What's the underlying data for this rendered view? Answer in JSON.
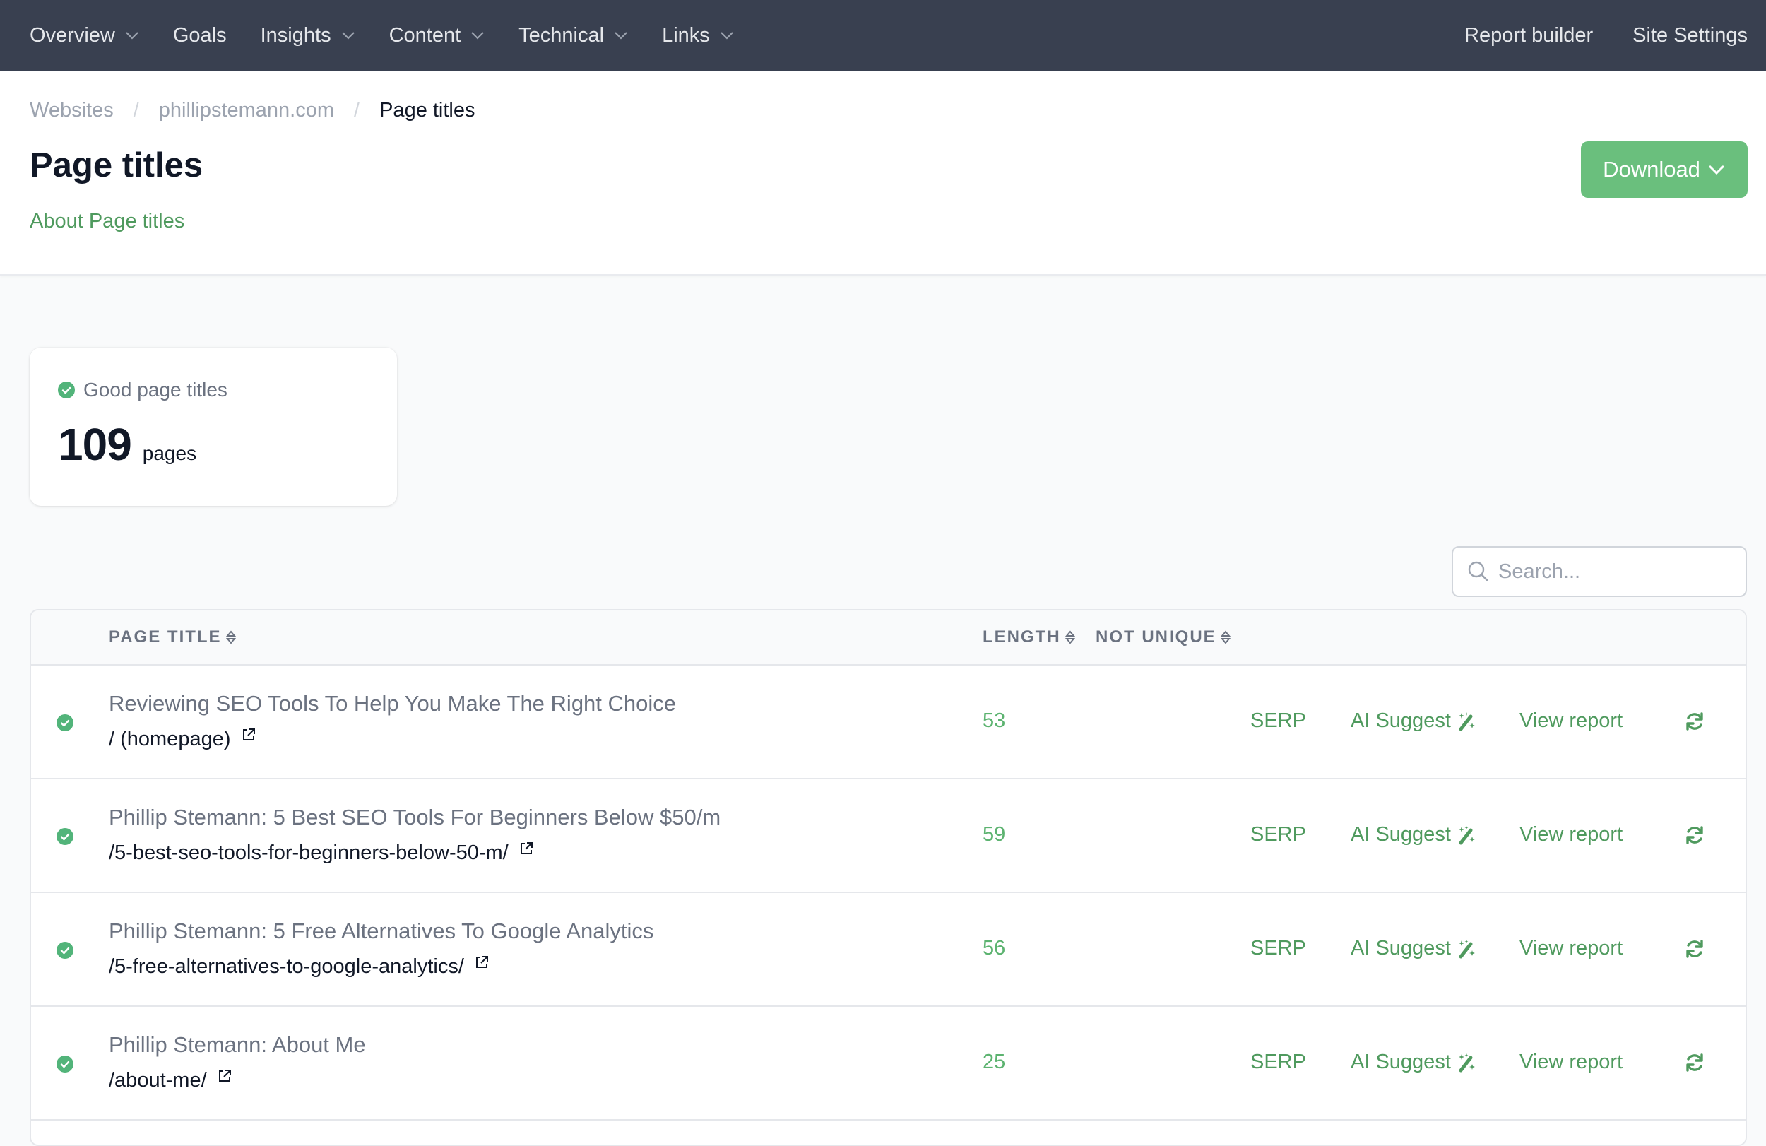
{
  "nav": {
    "left": [
      {
        "label": "Overview",
        "dropdown": true
      },
      {
        "label": "Goals",
        "dropdown": false
      },
      {
        "label": "Insights",
        "dropdown": true
      },
      {
        "label": "Content",
        "dropdown": true
      },
      {
        "label": "Technical",
        "dropdown": true
      },
      {
        "label": "Links",
        "dropdown": true
      }
    ],
    "right": [
      {
        "label": "Report builder"
      },
      {
        "label": "Site Settings"
      }
    ]
  },
  "breadcrumb": [
    "Websites",
    "phillipstemann.com",
    "Page titles"
  ],
  "breadcrumb_separator": "/",
  "page": {
    "title": "Page titles",
    "about_link": "About Page titles",
    "download_label": "Download"
  },
  "stat": {
    "label": "Good page titles",
    "value": "109",
    "unit": "pages",
    "status": "good"
  },
  "search": {
    "placeholder": "Search...",
    "value": ""
  },
  "table": {
    "columns": {
      "page_title": "PAGE TITLE",
      "length": "LENGTH",
      "not_unique": "NOT UNIQUE"
    },
    "actions": {
      "serp": "SERP",
      "ai_suggest": "AI Suggest",
      "view_report": "View report"
    },
    "rows": [
      {
        "status": "good",
        "title": "Reviewing SEO Tools To Help You Make The Right Choice",
        "url": "/ (homepage)",
        "length": "53",
        "not_unique": ""
      },
      {
        "status": "good",
        "title": "Phillip Stemann: 5 Best SEO Tools For Beginners Below $50/m",
        "url": "/5-best-seo-tools-for-beginners-below-50-m/",
        "length": "59",
        "not_unique": ""
      },
      {
        "status": "good",
        "title": "Phillip Stemann: 5 Free Alternatives To Google Analytics",
        "url": "/5-free-alternatives-to-google-analytics/",
        "length": "56",
        "not_unique": ""
      },
      {
        "status": "good",
        "title": "Phillip Stemann: About Me",
        "url": "/about-me/",
        "length": "25",
        "not_unique": ""
      }
    ]
  },
  "colors": {
    "nav_bg": "#394050",
    "accent_green": "#6abf7d",
    "link_green": "#4f9a5e",
    "check_green": "#52b47a"
  }
}
